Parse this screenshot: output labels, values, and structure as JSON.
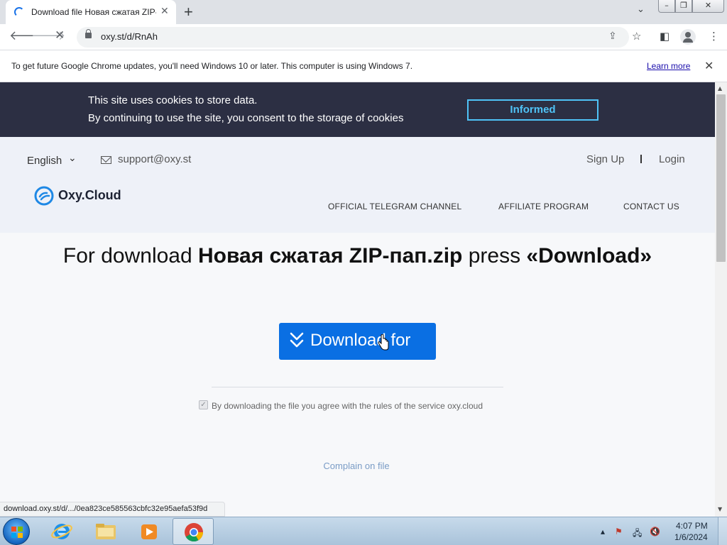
{
  "browser": {
    "tab_title": "Download file Новая сжатая ZIP-",
    "tab_close_glyph": "✕",
    "new_tab_glyph": "+",
    "tab_search_glyph": "⌄",
    "url": "oxy.st/d/RnAh",
    "window_controls": {
      "minimize": "–",
      "maximize": "❐",
      "close": "✕"
    }
  },
  "infobar": {
    "message": "To get future Google Chrome updates, you'll need Windows 10 or later. This computer is using Windows 7.",
    "link": "Learn more",
    "close_glyph": "✕"
  },
  "cookie_banner": {
    "line1": "This site uses cookies to store data.",
    "line2": "By continuing to use the site, you consent to the storage of cookies",
    "button": "Informed"
  },
  "header": {
    "language": "English",
    "support_email": "support@oxy.st",
    "sign_up": "Sign Up",
    "login": "Login",
    "logo_text": "Oxy.Cloud",
    "nav": [
      "OFFICIAL TELEGRAM CHANNEL",
      "AFFILIATE PROGRAM",
      "CONTACT US"
    ]
  },
  "main": {
    "headline_prefix": "For download ",
    "filename": "Новая сжатая ZIP-пап.zip",
    "headline_middle": " press ",
    "headline_action": "«Download»",
    "download_button": "Download for",
    "agree_text": "By downloading the file you agree with the rules of the service oxy.cloud",
    "complain_link": "Complain on file"
  },
  "status_url": "download.oxy.st/d/.../0ea823ce585563cbfc32e95aefa53f9d",
  "taskbar": {
    "time": "4:07 PM",
    "date": "1/6/2024",
    "apps": [
      "internet-explorer",
      "windows-explorer",
      "media-player",
      "google-chrome"
    ]
  },
  "colors": {
    "cookie_bg": "#2c2f43",
    "cookie_accent": "#4fc3f7",
    "download_button": "#0a6fe3",
    "header_bg": "#eef1f8"
  }
}
